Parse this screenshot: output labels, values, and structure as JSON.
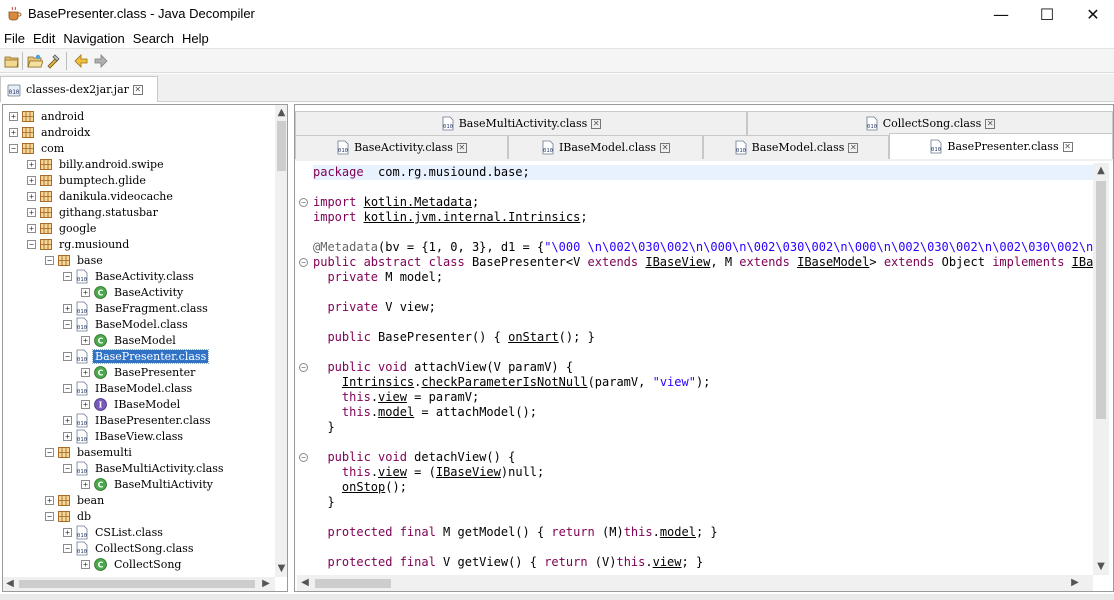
{
  "window": {
    "title": "BasePresenter.class - Java Decompiler",
    "minimize": "—",
    "maximize": "☐",
    "close": "✕"
  },
  "menu": [
    "File",
    "Edit",
    "Navigation",
    "Search",
    "Help"
  ],
  "toolbar": [
    "open-file-icon",
    "open-folder-icon",
    "open-type-icon",
    "back-icon",
    "forward-icon"
  ],
  "jar_tab": {
    "label": "classes-dex2jar.jar"
  },
  "tree": [
    {
      "label": "android",
      "depth": 0,
      "expander": "+",
      "kind": "package"
    },
    {
      "label": "androidx",
      "depth": 0,
      "expander": "+",
      "kind": "package"
    },
    {
      "label": "com",
      "depth": 0,
      "expander": "-",
      "kind": "package"
    },
    {
      "label": "billy.android.swipe",
      "depth": 1,
      "expander": "+",
      "kind": "package"
    },
    {
      "label": "bumptech.glide",
      "depth": 1,
      "expander": "+",
      "kind": "package"
    },
    {
      "label": "danikula.videocache",
      "depth": 1,
      "expander": "+",
      "kind": "package"
    },
    {
      "label": "githang.statusbar",
      "depth": 1,
      "expander": "+",
      "kind": "package"
    },
    {
      "label": "google",
      "depth": 1,
      "expander": "+",
      "kind": "package"
    },
    {
      "label": "rg.musiound",
      "depth": 1,
      "expander": "-",
      "kind": "package"
    },
    {
      "label": "base",
      "depth": 2,
      "expander": "-",
      "kind": "package"
    },
    {
      "label": "BaseActivity.class",
      "depth": 3,
      "expander": "-",
      "kind": "classfile"
    },
    {
      "label": "BaseActivity",
      "depth": 4,
      "expander": "+",
      "kind": "class-abstract"
    },
    {
      "label": "BaseFragment.class",
      "depth": 3,
      "expander": "+",
      "kind": "classfile"
    },
    {
      "label": "BaseModel.class",
      "depth": 3,
      "expander": "-",
      "kind": "classfile"
    },
    {
      "label": "BaseModel",
      "depth": 4,
      "expander": "+",
      "kind": "class-abstract"
    },
    {
      "label": "BasePresenter.class",
      "depth": 3,
      "expander": "-",
      "kind": "classfile",
      "selected": true
    },
    {
      "label": "BasePresenter",
      "depth": 4,
      "expander": "+",
      "kind": "class-abstract"
    },
    {
      "label": "IBaseModel.class",
      "depth": 3,
      "expander": "-",
      "kind": "classfile"
    },
    {
      "label": "IBaseModel",
      "depth": 4,
      "expander": "+",
      "kind": "interface"
    },
    {
      "label": "IBasePresenter.class",
      "depth": 3,
      "expander": "+",
      "kind": "classfile"
    },
    {
      "label": "IBaseView.class",
      "depth": 3,
      "expander": "+",
      "kind": "classfile"
    },
    {
      "label": "basemulti",
      "depth": 2,
      "expander": "-",
      "kind": "package"
    },
    {
      "label": "BaseMultiActivity.class",
      "depth": 3,
      "expander": "-",
      "kind": "classfile"
    },
    {
      "label": "BaseMultiActivity",
      "depth": 4,
      "expander": "+",
      "kind": "class-abstract"
    },
    {
      "label": "bean",
      "depth": 2,
      "expander": "+",
      "kind": "package"
    },
    {
      "label": "db",
      "depth": 2,
      "expander": "-",
      "kind": "package"
    },
    {
      "label": "CSList.class",
      "depth": 3,
      "expander": "+",
      "kind": "classfile"
    },
    {
      "label": "CollectSong.class",
      "depth": 3,
      "expander": "-",
      "kind": "classfile"
    },
    {
      "label": "CollectSong",
      "depth": 4,
      "expander": "+",
      "kind": "class"
    }
  ],
  "file_tabs_row1": [
    {
      "label": "BaseMultiActivity.class"
    },
    {
      "label": "CollectSong.class"
    }
  ],
  "file_tabs_row2": [
    {
      "label": "BaseActivity.class"
    },
    {
      "label": "IBaseModel.class"
    },
    {
      "label": "BaseModel.class"
    },
    {
      "label": "BasePresenter.class",
      "active": true
    }
  ],
  "code_lines": [
    {
      "segs": [
        [
          "kw",
          "package"
        ],
        [
          "",
          "  com.rg.musiound.base;"
        ]
      ],
      "hl": true
    },
    {
      "segs": []
    },
    {
      "segs": [
        [
          "kw",
          "import"
        ],
        [
          "",
          " "
        ],
        [
          "ul",
          "kotlin.Metadata"
        ],
        [
          "",
          ";"
        ]
      ],
      "fold": "-"
    },
    {
      "segs": [
        [
          "kw",
          "import"
        ],
        [
          "",
          " "
        ],
        [
          "ul",
          "kotlin.jvm.internal.Intrinsics"
        ],
        [
          "",
          ";"
        ]
      ]
    },
    {
      "segs": []
    },
    {
      "segs": [
        [
          "ann",
          "@Metadata"
        ],
        [
          "",
          "(bv = {1, 0, 3}, d1 = {"
        ],
        [
          "str",
          "\"\\000 \\n\\002\\030\\002\\n\\000\\n\\002\\030\\002\\n\\000\\n\\002\\030\\002\\n\\002\\030\\002\\n\\0"
        ]
      ]
    },
    {
      "segs": [
        [
          "kw",
          "public abstract class"
        ],
        [
          "",
          " BasePresenter<V "
        ],
        [
          "kw",
          "extends"
        ],
        [
          "",
          " "
        ],
        [
          "ul",
          "IBaseView"
        ],
        [
          "",
          ", M "
        ],
        [
          "kw",
          "extends"
        ],
        [
          "",
          " "
        ],
        [
          "ul",
          "IBaseModel"
        ],
        [
          "",
          "> "
        ],
        [
          "kw",
          "extends"
        ],
        [
          "",
          " Object "
        ],
        [
          "kw",
          "implements"
        ],
        [
          "",
          " "
        ],
        [
          "ul",
          "IBase"
        ]
      ],
      "fold": "-"
    },
    {
      "segs": [
        [
          "",
          "  "
        ],
        [
          "kw",
          "private"
        ],
        [
          "",
          " M model;"
        ]
      ]
    },
    {
      "segs": []
    },
    {
      "segs": [
        [
          "",
          "  "
        ],
        [
          "kw",
          "private"
        ],
        [
          "",
          " V view;"
        ]
      ]
    },
    {
      "segs": []
    },
    {
      "segs": [
        [
          "",
          "  "
        ],
        [
          "kw",
          "public"
        ],
        [
          "",
          " BasePresenter() { "
        ],
        [
          "ul",
          "onStart"
        ],
        [
          "",
          "(); }"
        ]
      ]
    },
    {
      "segs": []
    },
    {
      "segs": [
        [
          "",
          "  "
        ],
        [
          "kw",
          "public void"
        ],
        [
          "",
          " attachView(V paramV) {"
        ]
      ],
      "fold": "-"
    },
    {
      "segs": [
        [
          "",
          "    "
        ],
        [
          "ul",
          "Intrinsics"
        ],
        [
          "",
          "."
        ],
        [
          "ul",
          "checkParameterIsNotNull"
        ],
        [
          "",
          "(paramV, "
        ],
        [
          "str",
          "\"view\""
        ],
        [
          "",
          ");"
        ]
      ]
    },
    {
      "segs": [
        [
          "",
          "    "
        ],
        [
          "kw",
          "this"
        ],
        [
          "",
          "."
        ],
        [
          "ul",
          "view"
        ],
        [
          "",
          " = paramV;"
        ]
      ]
    },
    {
      "segs": [
        [
          "",
          "    "
        ],
        [
          "kw",
          "this"
        ],
        [
          "",
          "."
        ],
        [
          "ul",
          "model"
        ],
        [
          "",
          " = attachModel();"
        ]
      ]
    },
    {
      "segs": [
        [
          "",
          "  }"
        ]
      ]
    },
    {
      "segs": []
    },
    {
      "segs": [
        [
          "",
          "  "
        ],
        [
          "kw",
          "public void"
        ],
        [
          "",
          " detachView() {"
        ]
      ],
      "fold": "-"
    },
    {
      "segs": [
        [
          "",
          "    "
        ],
        [
          "kw",
          "this"
        ],
        [
          "",
          "."
        ],
        [
          "ul",
          "view"
        ],
        [
          "",
          " = ("
        ],
        [
          "ul",
          "IBaseView"
        ],
        [
          "",
          ")null;"
        ]
      ]
    },
    {
      "segs": [
        [
          "",
          "    "
        ],
        [
          "ul",
          "onStop"
        ],
        [
          "",
          "();"
        ]
      ]
    },
    {
      "segs": [
        [
          "",
          "  }"
        ]
      ]
    },
    {
      "segs": []
    },
    {
      "segs": [
        [
          "",
          "  "
        ],
        [
          "kw",
          "protected final"
        ],
        [
          "",
          " M getModel() { "
        ],
        [
          "kw",
          "return"
        ],
        [
          "",
          " (M)"
        ],
        [
          "kw",
          "this"
        ],
        [
          "",
          "."
        ],
        [
          "ul",
          "model"
        ],
        [
          "",
          "; }"
        ]
      ]
    },
    {
      "segs": []
    },
    {
      "segs": [
        [
          "",
          "  "
        ],
        [
          "kw",
          "protected final"
        ],
        [
          "",
          " V getView() { "
        ],
        [
          "kw",
          "return"
        ],
        [
          "",
          " (V)"
        ],
        [
          "kw",
          "this"
        ],
        [
          "",
          "."
        ],
        [
          "ul",
          "view"
        ],
        [
          "",
          "; }"
        ]
      ]
    }
  ]
}
